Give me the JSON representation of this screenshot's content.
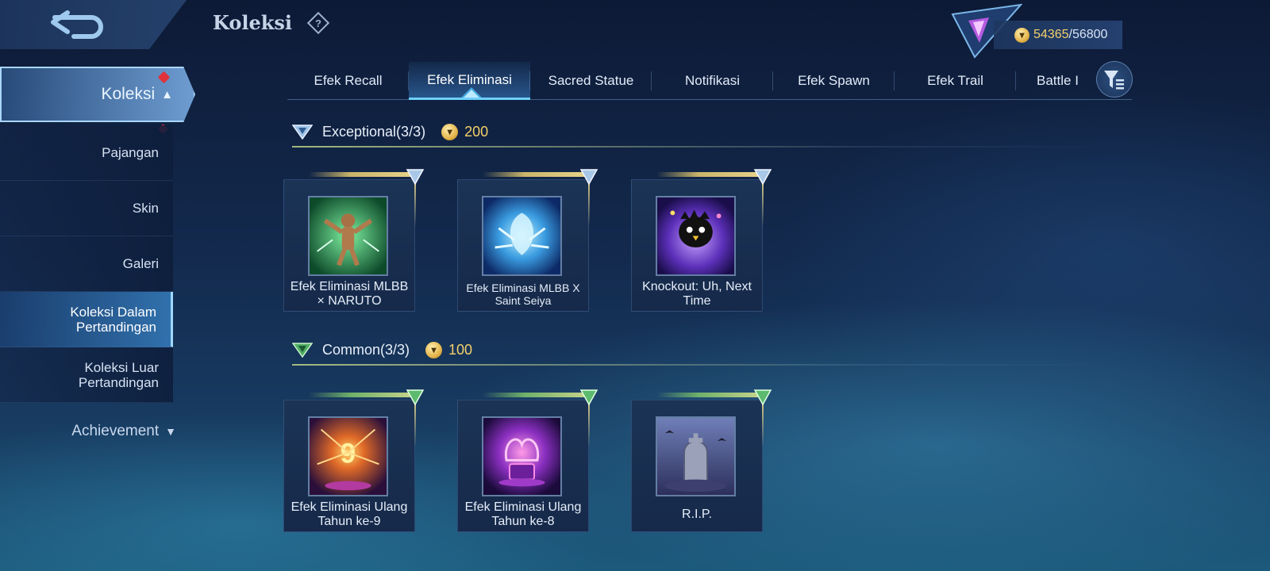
{
  "header": {
    "title": "Koleksi",
    "currency_current": "54365",
    "currency_separator": "/",
    "currency_max": "56800"
  },
  "sidebar": {
    "main_item": "Koleksi",
    "items": [
      {
        "label": "Pajangan"
      },
      {
        "label": "Skin"
      },
      {
        "label": "Galeri"
      },
      {
        "label": "Koleksi Dalam Pertandingan"
      },
      {
        "label": "Koleksi Luar Pertandingan"
      }
    ],
    "achievement": "Achievement"
  },
  "tabs": [
    {
      "label": "Efek Recall"
    },
    {
      "label": "Efek Eliminasi"
    },
    {
      "label": "Sacred Statue"
    },
    {
      "label": "Notifikasi"
    },
    {
      "label": "Efek Spawn"
    },
    {
      "label": "Efek Trail"
    },
    {
      "label": "Battle I"
    }
  ],
  "active_tab": "Efek Eliminasi",
  "sections": [
    {
      "title": "Exceptional(3/3)",
      "points": "200",
      "items": [
        {
          "label": "Efek Eliminasi MLBB × NARUTO"
        },
        {
          "label": "Efek Eliminasi MLBB X Saint Seiya"
        },
        {
          "label": "Knockout: Uh, Next Time"
        }
      ]
    },
    {
      "title": "Common(3/3)",
      "points": "100",
      "items": [
        {
          "label": "Efek Eliminasi Ulang Tahun ke-9"
        },
        {
          "label": "Efek Eliminasi Ulang Tahun ke-8"
        },
        {
          "label": "R.I.P."
        }
      ]
    }
  ],
  "colors": {
    "accent": "#6fd0ff",
    "gold": "#f4d06a",
    "alert": "#e0323a"
  },
  "icons": {
    "back": "back-arrow-icon",
    "help": "question-mark-icon",
    "rank": "rank-emblem-icon",
    "filter": "filter-icon",
    "coin": "coin-icon",
    "exceptional": "exceptional-rarity-icon",
    "common": "common-rarity-icon"
  }
}
